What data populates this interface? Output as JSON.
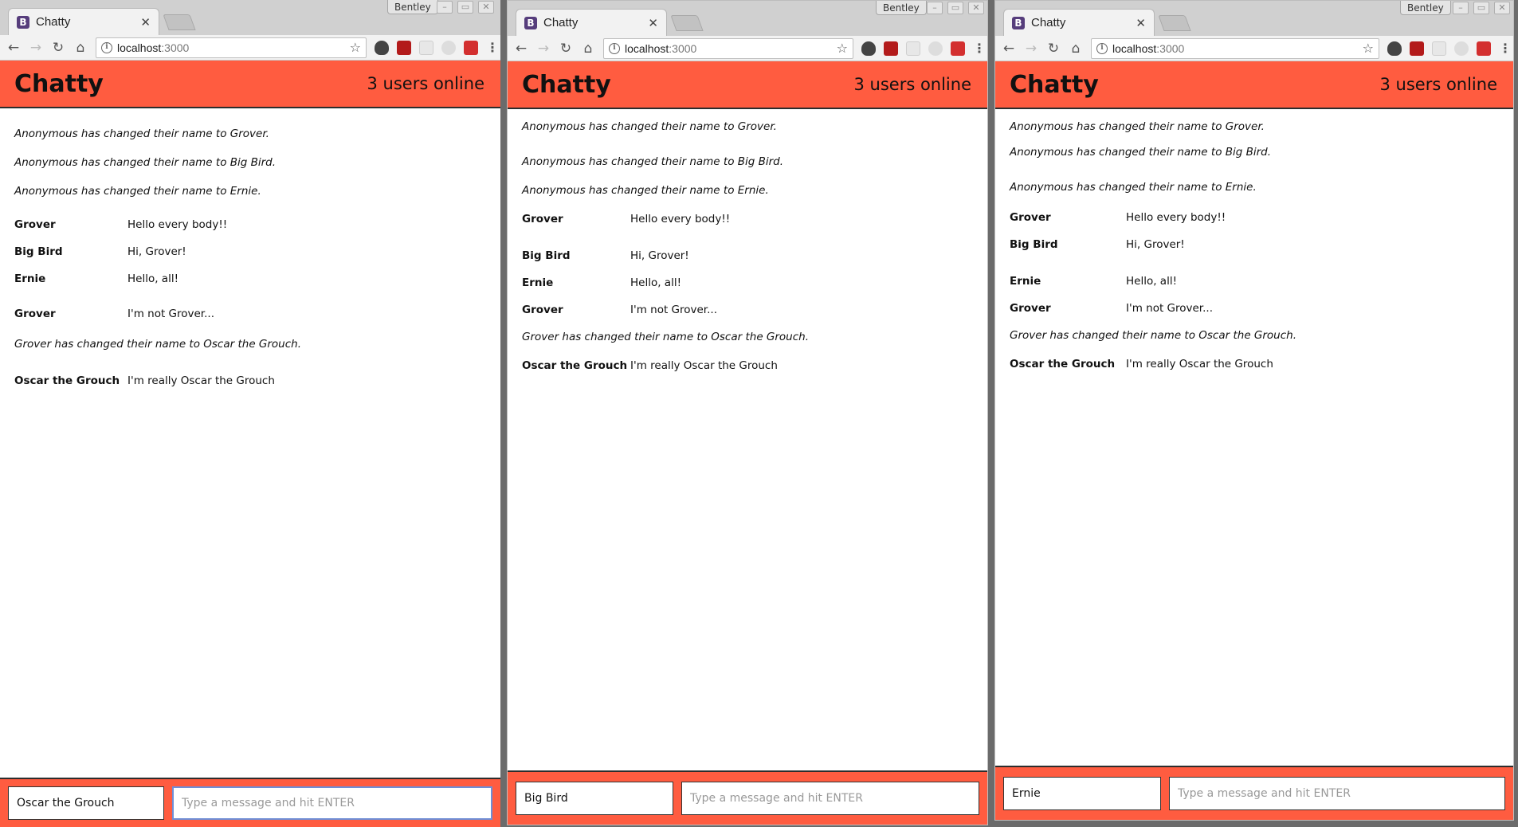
{
  "browser": {
    "tab_title": "Chatty",
    "tab_close": "×",
    "favicon_letter": "B",
    "profile_name": "Bentley",
    "url_host": "localhost",
    "url_port": ":3000",
    "icons": {
      "back": "←",
      "forward": "→",
      "reload": "↻",
      "home": "⌂",
      "star": "☆",
      "menu": "⋮",
      "info": "i",
      "minimize": "–",
      "maximize": "▭",
      "close": "✕"
    }
  },
  "app": {
    "brand": "Chatty",
    "online": "3 users online",
    "message_placeholder": "Type a message and hit ENTER",
    "accent_color": "#ff5c40"
  },
  "messages": {
    "sys1": "Anonymous has changed their name to Grover.",
    "sys2": "Anonymous has changed their name to Big Bird.",
    "sys3": "Anonymous has changed their name to Ernie.",
    "m1_user": "Grover",
    "m1_text": "Hello every body!!",
    "m2_user": "Big Bird",
    "m2_text": "Hi, Grover!",
    "m3_user": "Ernie",
    "m3_text": "Hello, all!",
    "m4_user": "Grover",
    "m4_text": "I'm not Grover...",
    "sys4": "Grover has changed their name to Oscar the Grouch.",
    "m5_user": "Oscar the Grouch",
    "m5_text": "I'm really Oscar the Grouch"
  },
  "windows": [
    {
      "username": "Oscar the Grouch"
    },
    {
      "username": "Big Bird"
    },
    {
      "username": "Ernie"
    }
  ]
}
